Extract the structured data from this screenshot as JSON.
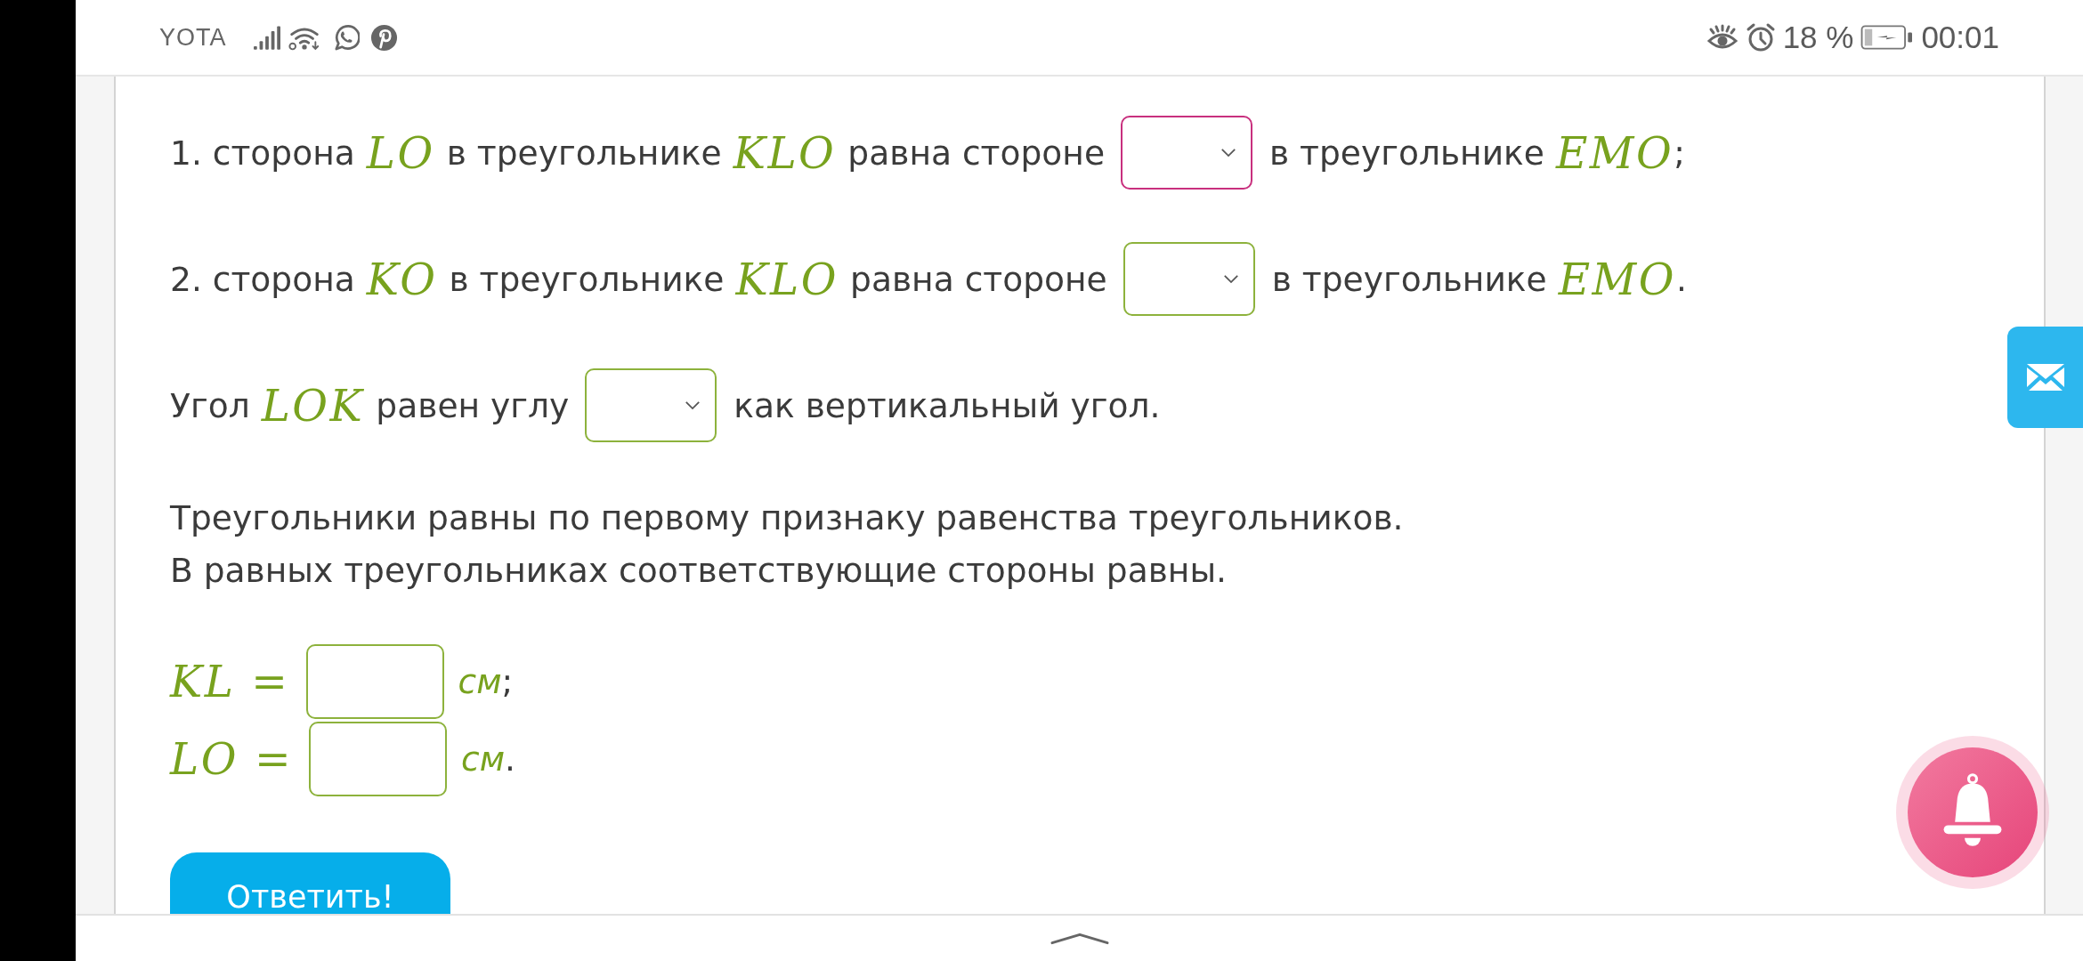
{
  "status_bar": {
    "carrier": "YOTA",
    "battery": "18 %",
    "time": "00:01"
  },
  "exercise": {
    "statements": [
      {
        "parts": [
          {
            "kind": "text",
            "text": "1. сторона"
          },
          {
            "kind": "math",
            "text": "LO"
          },
          {
            "kind": "text",
            "text": "в треугольнике"
          },
          {
            "kind": "math",
            "text": "KLO"
          },
          {
            "kind": "text",
            "text": "равна стороне"
          },
          {
            "kind": "select",
            "focused": true
          },
          {
            "kind": "text",
            "text": "в треугольнике"
          },
          {
            "kind": "math",
            "text": "EMO"
          },
          {
            "kind": "punct",
            "text": ";"
          }
        ]
      },
      {
        "parts": [
          {
            "kind": "text",
            "text": "2. сторона"
          },
          {
            "kind": "math",
            "text": "KO"
          },
          {
            "kind": "text",
            "text": "в треугольнике"
          },
          {
            "kind": "math",
            "text": "KLO"
          },
          {
            "kind": "text",
            "text": "равна стороне"
          },
          {
            "kind": "select",
            "focused": false
          },
          {
            "kind": "text",
            "text": "в треугольнике"
          },
          {
            "kind": "math",
            "text": "EMO"
          },
          {
            "kind": "punct",
            "text": "."
          }
        ]
      },
      {
        "parts": [
          {
            "kind": "text",
            "text": "Угол"
          },
          {
            "kind": "math",
            "text": "LOK"
          },
          {
            "kind": "text",
            "text": "равен углу"
          },
          {
            "kind": "select",
            "focused": false
          },
          {
            "kind": "text",
            "text": "как вертикальный угол."
          }
        ]
      }
    ],
    "explanation": [
      "Треугольники равны по первому признаку равенства треугольников.",
      "В равных треугольниках соответствующие стороны равны."
    ],
    "equations": [
      {
        "parts": [
          {
            "kind": "math",
            "text": "KL ="
          },
          {
            "kind": "input",
            "focused": false
          },
          {
            "kind": "unit",
            "text": "см"
          },
          {
            "kind": "punct",
            "text": ";"
          }
        ]
      },
      {
        "parts": [
          {
            "kind": "math",
            "text": "LO ="
          },
          {
            "kind": "input",
            "focused": false
          },
          {
            "kind": "unit",
            "text": "см"
          },
          {
            "kind": "punct",
            "text": "."
          }
        ]
      }
    ],
    "submit_button": {
      "label": "Ответить!"
    }
  }
}
